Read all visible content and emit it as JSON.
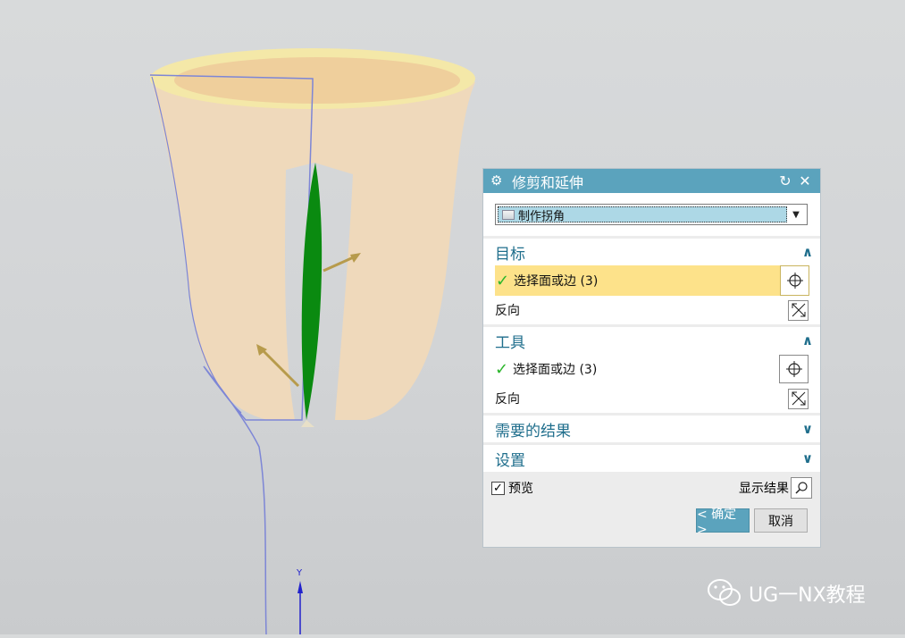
{
  "dialog": {
    "title": "修剪和延伸",
    "type_value": "制作拐角",
    "sections": {
      "target": {
        "title": "目标",
        "select_label": "选择面或边 (3)",
        "reverse_label": "反向"
      },
      "tool": {
        "title": "工具",
        "select_label": "选择面或边 (3)",
        "reverse_label": "反向"
      },
      "required_result": {
        "title": "需要的结果"
      },
      "settings": {
        "title": "设置"
      }
    },
    "preview_label": "预览",
    "show_result_label": "显示结果",
    "ok_label": "< 确定 >",
    "cancel_label": "取消"
  },
  "viewport": {
    "axis_label": "Y"
  },
  "watermark": {
    "text": "UG一NX教程"
  },
  "colors": {
    "title_bar": "#5ba3bd",
    "selected_row": "#fde28a",
    "section_title": "#1f6e8c",
    "check": "#2bb62b",
    "surface": "#f1d9b8",
    "tool_face": "#0a8a10"
  }
}
